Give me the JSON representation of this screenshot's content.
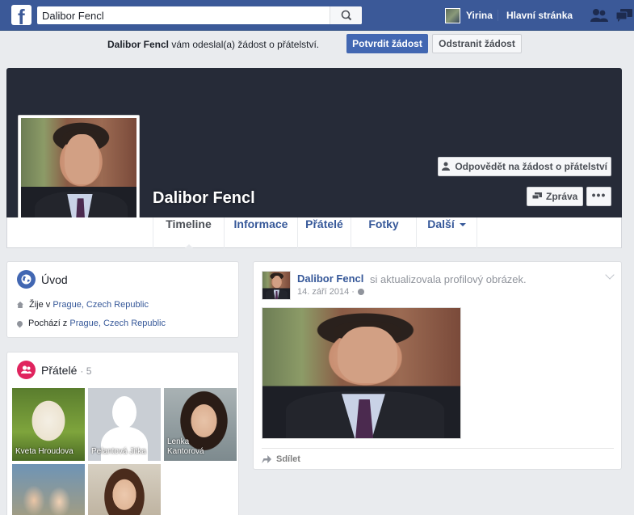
{
  "topbar": {
    "logo": "f",
    "search_value": "Dalibor Fencl",
    "user_name": "Yirina",
    "home_label": "Hlavní stránka"
  },
  "friend_request": {
    "name": "Dalibor Fencl",
    "text": "vám odeslal(a) žádost o přátelství.",
    "confirm_label": "Potvrdit žádost",
    "delete_label": "Odstranit žádost"
  },
  "profile": {
    "name": "Dalibor Fencl",
    "respond_label": "Odpovědět na žádost o přátelství",
    "message_label": "Zpráva",
    "more_label": "•••"
  },
  "tabs": {
    "timeline": "Timeline",
    "info": "Informace",
    "friends": "Přátelé",
    "photos": "Fotky",
    "more": "Další"
  },
  "intro": {
    "title": "Úvod",
    "lives_prefix": "Žije v",
    "lives_place": "Prague, Czech Republic",
    "from_prefix": "Pochází z",
    "from_place": "Prague, Czech Republic"
  },
  "friends_section": {
    "title": "Přátelé",
    "count": "· 5",
    "items": [
      {
        "name": "Kveta Hroudova"
      },
      {
        "name": "Pelantová Jitka"
      },
      {
        "name": "Lenka Kantorová"
      },
      {
        "name": ""
      },
      {
        "name": ""
      }
    ]
  },
  "post": {
    "author": "Dalibor Fencl",
    "action": "si aktualizovala profilový obrázek.",
    "date": "14. září 2014 ·",
    "share_label": "Sdílet"
  },
  "colors": {
    "brand": "#3b5998",
    "button_blue": "#4267b2",
    "link": "#365899",
    "cover": "#262b38"
  },
  "icons": [
    "facebook-logo-icon",
    "search-icon",
    "friend-requests-icon",
    "messages-icon",
    "globe-icon",
    "location-pin-icon",
    "home-icon",
    "share-icon"
  ]
}
